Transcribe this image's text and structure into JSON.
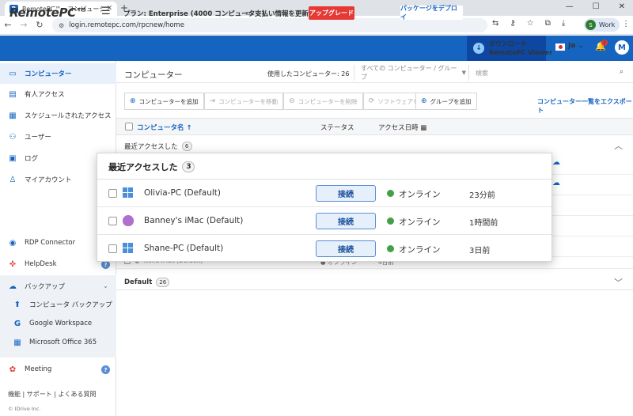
{
  "browser": {
    "tab_title": "RemotePC™ - コンピューター",
    "tab_favicon": "R",
    "url": "login.remotepc.com/rpcnew/home",
    "profile_label": "Work",
    "profile_initial": "S"
  },
  "header": {
    "logo": "RemotePC™",
    "plan": "プラン: Enterprise (4000 コンピューター)",
    "billing": "支払い情報を更新",
    "upgrade": "アップグレード",
    "deploy": "パッケージをデプロイ",
    "download_line1": "ダウンロード",
    "download_line2": "RemotePC Viewer",
    "language": "Ja",
    "notifications": "1",
    "user_initial": "M"
  },
  "sidebar": {
    "items": [
      {
        "label": "コンピューター"
      },
      {
        "label": "有人アクセス"
      },
      {
        "label": "スケジュールされたアクセス"
      },
      {
        "label": "ユーザー"
      },
      {
        "label": "ログ"
      },
      {
        "label": "マイアカウント"
      },
      {
        "label": "RDP Connector"
      },
      {
        "label": "HelpDesk"
      },
      {
        "label": "バックアップ"
      },
      {
        "label": "コンピュータ バックアップ"
      },
      {
        "label": "Google Workspace"
      },
      {
        "label": "Microsoft Office 365"
      },
      {
        "label": "Meeting"
      }
    ],
    "footer_links": "機能 | サポート | よくある質問",
    "copyright": "© IDrive Inc."
  },
  "main": {
    "title": "コンピューター",
    "used_count": "使用したコンピューター: 26",
    "group_select": "すべての コンピューター / グループ",
    "search_placeholder": "検索",
    "toolbar": {
      "add": "コンピューターを追加",
      "move": "コンピューターを移動",
      "delete": "コンピューターを削除",
      "update": "ソフトウェアを更新",
      "add_group": "グループを追加",
      "export": "コンピューター一覧をエクスポート"
    },
    "columns": {
      "name": "コンピュータ名 ↑",
      "status": "ステータス",
      "access": "アクセス日時"
    },
    "recent_group": {
      "label": "最近アクセスした",
      "count": "6"
    },
    "partial_row": {
      "name": "Nona iMac (Default)",
      "status": "● オフライン",
      "time": "4日前"
    },
    "default_group": {
      "label": "Default",
      "count": "26"
    }
  },
  "popup": {
    "title": "最近アクセスした",
    "count": "3",
    "rows": [
      {
        "name": "Olivia-PC (Default)",
        "os": "windows-icon",
        "connect": "接続",
        "status": "オンライン",
        "time": "23分前"
      },
      {
        "name": "Banney's iMac (Default)",
        "os": "apple-icon",
        "connect": "接続",
        "status": "オンライン",
        "time": "1時間前"
      },
      {
        "name": "Shane-PC (Default)",
        "os": "windows-icon",
        "connect": "接続",
        "status": "オンライン",
        "time": "3日前"
      }
    ]
  },
  "colors": {
    "brand": "#1565c0",
    "online": "#43a047",
    "upgrade": "#e53935"
  }
}
